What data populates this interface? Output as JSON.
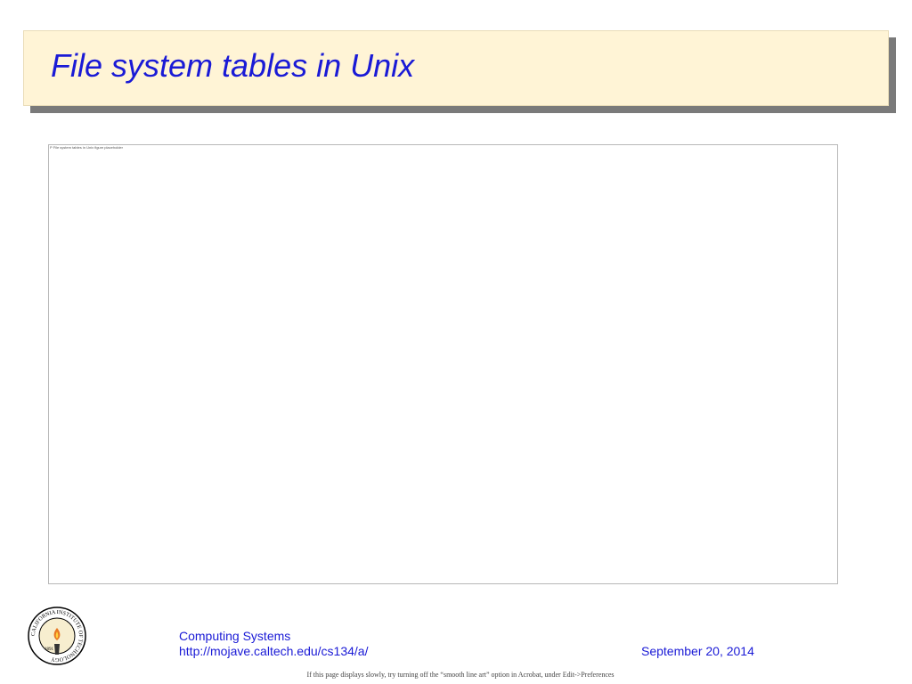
{
  "slide": {
    "title": "File system tables in Unix"
  },
  "figure": {
    "corner_mark": "P",
    "corner_caption": "File system tables in Unix figure placeholder"
  },
  "logo": {
    "icon": "caltech-seal-icon",
    "ring_text": "CALIFORNIA INSTITUTE OF TECHNOLOGY",
    "year": "1891"
  },
  "footer": {
    "course": "Computing Systems",
    "url": "http://mojave.caltech.edu/cs134/a/",
    "date": "September 20, 2014",
    "note": "If this page displays slowly, try turning off the “smooth line art” option in Acrobat, under Edit->Preferences"
  },
  "colors": {
    "title_text": "#1a1ad6",
    "title_background": "#fff4d6",
    "title_shadow": "#7a7a7a",
    "footer_text": "#1a1ad6"
  }
}
